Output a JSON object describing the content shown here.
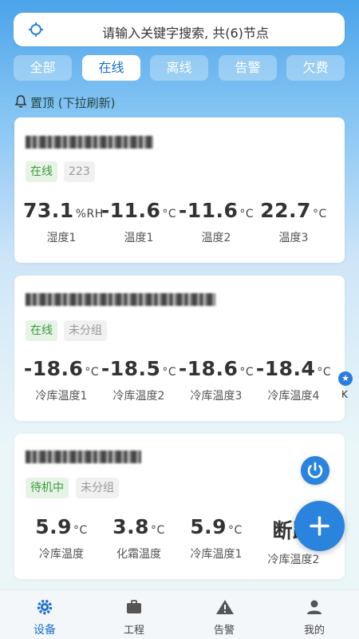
{
  "search": {
    "placeholder_text": "请输入关键字搜索, 共(6)节点"
  },
  "tabs": [
    {
      "label": "全部",
      "active": false
    },
    {
      "label": "在线",
      "active": true
    },
    {
      "label": "离线",
      "active": false
    },
    {
      "label": "告警",
      "active": false
    },
    {
      "label": "欠费",
      "active": false
    }
  ],
  "pinned_label": "置顶 (下拉刷新)",
  "cards": [
    {
      "badges": [
        "在线",
        "223"
      ],
      "metrics": [
        {
          "value": "73.1",
          "unit": "%RH",
          "label": "湿度1"
        },
        {
          "value": "-11.6",
          "unit": "°C",
          "label": "温度1"
        },
        {
          "value": "-11.6",
          "unit": "°C",
          "label": "温度2"
        },
        {
          "value": "22.7",
          "unit": "°C",
          "label": "温度3"
        }
      ]
    },
    {
      "badges": [
        "在线",
        "未分组"
      ],
      "metrics": [
        {
          "value": "-18.6",
          "unit": "°C",
          "label": "冷库温度1"
        },
        {
          "value": "-18.5",
          "unit": "°C",
          "label": "冷库温度2"
        },
        {
          "value": "-18.6",
          "unit": "°C",
          "label": "冷库温度3"
        },
        {
          "value": "-18.4",
          "unit": "°C",
          "label": "冷库温度4"
        }
      ]
    },
    {
      "badges": [
        "待机中",
        "未分组"
      ],
      "metrics": [
        {
          "value": "5.9",
          "unit": "°C",
          "label": "冷库温度"
        },
        {
          "value": "3.8",
          "unit": "°C",
          "label": "化霜温度"
        },
        {
          "value": "5.9",
          "unit": "°C",
          "label": "冷库温度1"
        },
        {
          "value": "断路",
          "unit": "",
          "label": "冷库温度2"
        }
      ]
    }
  ],
  "side": {
    "star": "★",
    "letter": "K"
  },
  "bottom_nav": [
    {
      "label": "设备",
      "icon": "gear-icon",
      "active": true
    },
    {
      "label": "工程",
      "icon": "briefcase-icon",
      "active": false
    },
    {
      "label": "告警",
      "icon": "warning-icon",
      "active": false
    },
    {
      "label": "我的",
      "icon": "person-icon",
      "active": false
    }
  ],
  "colors": {
    "accent": "#2a83dd",
    "online": "#3a9a3a"
  }
}
